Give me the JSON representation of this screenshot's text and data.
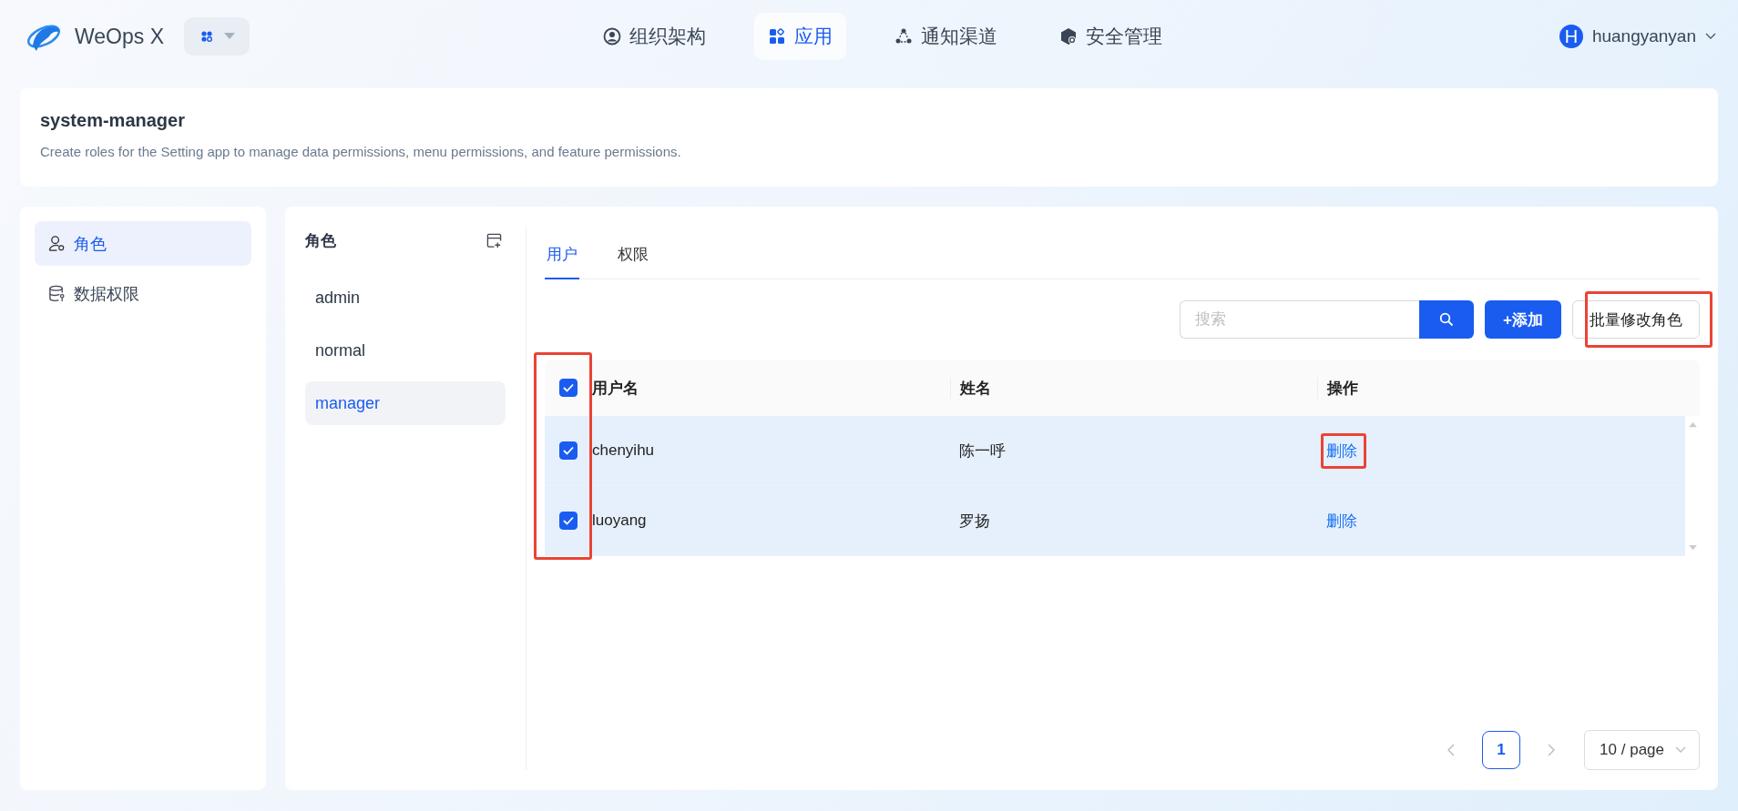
{
  "header": {
    "logo_text": "WeOps X"
  },
  "nav": [
    {
      "label": "组织架构",
      "selected": false
    },
    {
      "label": "应用",
      "selected": true
    },
    {
      "label": "通知渠道",
      "selected": false
    },
    {
      "label": "安全管理",
      "selected": false
    }
  ],
  "user": {
    "initial": "H",
    "name": "huangyanyan"
  },
  "app": {
    "title": "system-manager",
    "description": "Create roles for the Setting app to manage data permissions, menu permissions, and feature permissions."
  },
  "sidebar": {
    "items": [
      {
        "label": "角色",
        "selected": true
      },
      {
        "label": "数据权限",
        "selected": false
      }
    ]
  },
  "roles": {
    "title": "角色",
    "items": [
      {
        "label": "admin",
        "selected": false
      },
      {
        "label": "normal",
        "selected": false
      },
      {
        "label": "manager",
        "selected": true
      }
    ]
  },
  "tabs": [
    {
      "label": "用户",
      "selected": true
    },
    {
      "label": "权限",
      "selected": false
    }
  ],
  "search": {
    "placeholder": "搜索"
  },
  "buttons": {
    "add": "+添加",
    "batch": "批量修改角色",
    "batch_highlighted": true
  },
  "table": {
    "columns": [
      "用户名",
      "姓名",
      "操作"
    ],
    "all_checked": true,
    "checkbox_column_highlighted": true,
    "rows": [
      {
        "username": "chenyihu",
        "name": "陈一呼",
        "action": "删除",
        "checked": true,
        "action_highlighted": true
      },
      {
        "username": "luoyang",
        "name": "罗扬",
        "action": "删除",
        "checked": true,
        "action_highlighted": false
      }
    ]
  },
  "pagination": {
    "pages": [
      {
        "label": "1",
        "selected": true
      }
    ],
    "page_size": "10 / page"
  }
}
